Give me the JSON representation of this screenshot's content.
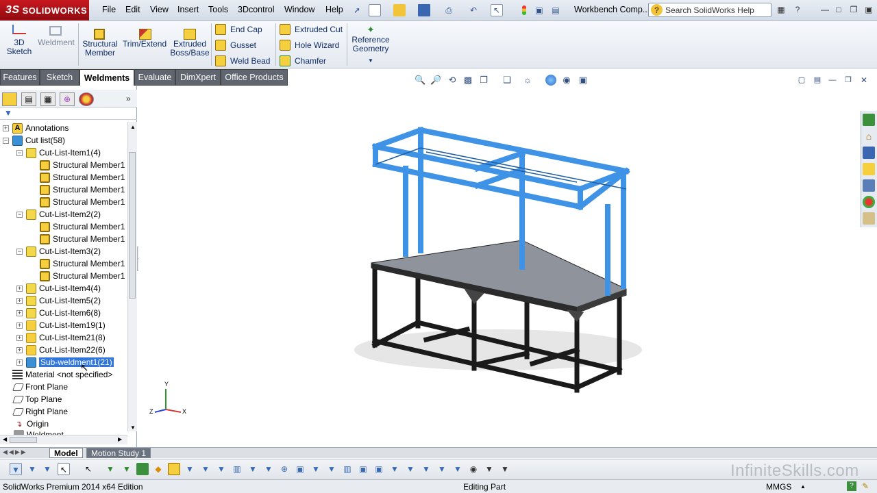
{
  "app": {
    "logo_ds": "3S",
    "logo_text": "SOLIDWORKS",
    "doc_title": "Workbench Comp...",
    "search_placeholder": "Search SolidWorks Help"
  },
  "menu": [
    "File",
    "Edit",
    "View",
    "Insert",
    "Tools",
    "3Dcontrol",
    "Window",
    "Help"
  ],
  "ribbon": {
    "big": [
      {
        "line1": "3D",
        "line2": "Sketch"
      },
      {
        "line1": "Weldment",
        "line2": ""
      },
      {
        "line1": "Structural",
        "line2": "Member"
      },
      {
        "line1": "Trim/Extend",
        "line2": ""
      },
      {
        "line1": "Extruded",
        "line2": "Boss/Base"
      }
    ],
    "col1": [
      "End Cap",
      "Gusset",
      "Weld Bead"
    ],
    "col2": [
      "Extruded Cut",
      "Hole Wizard",
      "Chamfer"
    ],
    "ref": {
      "line1": "Reference",
      "line2": "Geometry"
    }
  },
  "tabs": [
    "Features",
    "Sketch",
    "Weldments",
    "Evaluate",
    "DimXpert",
    "Office Products"
  ],
  "tree": {
    "annotations": "Annotations",
    "cutlist": "Cut list(58)",
    "cli1": "Cut-List-Item1(4)",
    "cli2": "Cut-List-Item2(2)",
    "cli3": "Cut-List-Item3(2)",
    "cli4": "Cut-List-Item4(4)",
    "cli5": "Cut-List-Item5(2)",
    "cli6": "Cut-List-Item6(8)",
    "cli19": "Cut-List-Item19(1)",
    "cli21": "Cut-List-Item21(8)",
    "cli22": "Cut-List-Item22(6)",
    "subweld": "Sub-weldment1(21)",
    "member": "Structural Member1",
    "material": "Material <not specified>",
    "front": "Front Plane",
    "top": "Top Plane",
    "right": "Right Plane",
    "origin": "Origin",
    "weld_partial": "Weldment"
  },
  "triad": {
    "y": "Y",
    "z": "Z",
    "x": "X"
  },
  "bottom_tabs": [
    "Model",
    "Motion Study 1"
  ],
  "watermark": "InfiniteSkills.com",
  "status": {
    "edition": "SolidWorks Premium 2014 x64 Edition",
    "mode": "Editing Part",
    "units": "MMGS"
  },
  "colors": {
    "accent": "#3276d9",
    "frame_blue": "#3f93e6",
    "logo_red": "#c8181f"
  }
}
